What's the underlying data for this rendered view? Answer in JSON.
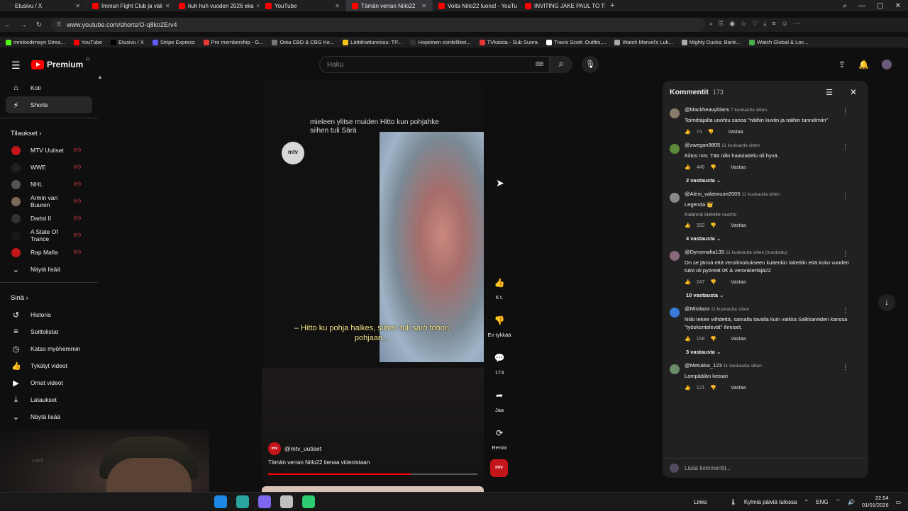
{
  "browser": {
    "tabs": [
      {
        "label": "Etusivu / X",
        "color": "#222222",
        "active": false
      },
      {
        "label": "Immun Fight Club ja vali",
        "color": "#ff0000",
        "active": false
      },
      {
        "label": "huh huh vuoden 2026 eka",
        "color": "#ff0000",
        "active": false
      },
      {
        "label": "YouTube",
        "color": "#ff0000",
        "active": false
      },
      {
        "label": "Tämän verran Niilo22",
        "color": "#ff0000",
        "active": true
      },
      {
        "label": "Voita Niilo22 luona! - YouTu",
        "color": "#ff0000",
        "active": false
      },
      {
        "label": "INVITING JAKE PAUL TO TI",
        "color": "#ff0000",
        "active": false
      }
    ],
    "url": "www.youtube.com/shorts/O-q8ko2Erv4",
    "bookmarks": [
      {
        "label": "mmikedimayn Strea...",
        "color": "#53fc18"
      },
      {
        "label": "YouTube",
        "color": "#ff0000"
      },
      {
        "label": "Etusivu / X",
        "color": "#000000"
      },
      {
        "label": "Stripe Express",
        "color": "#635bff"
      },
      {
        "label": "Pro membership - G...",
        "color": "#e53935"
      },
      {
        "label": "Osta CBD & CBG Ke...",
        "color": "#777777"
      },
      {
        "label": "Lättähattureissu: TP...",
        "color": "#f5c518"
      },
      {
        "label": "Hopeinen cordelliket...",
        "color": "#333333"
      },
      {
        "label": "TVkaista - Sub Suora",
        "color": "#e53935"
      },
      {
        "label": "Travis Scott: Outfits,...",
        "color": "#ffffff"
      },
      {
        "label": "Watch Marvel's Luk...",
        "color": "#aaaaaa"
      },
      {
        "label": "Mighty Ducks: Bank...",
        "color": "#aaaaaa"
      },
      {
        "label": "Watch Global & Loc...",
        "color": "#4caf50"
      }
    ]
  },
  "youtube": {
    "logo_text": "Premium",
    "region": "FI",
    "search_placeholder": "Haku"
  },
  "sidebar": {
    "main": [
      {
        "label": "Koti",
        "icon": "⌂",
        "icon_name": "home-icon",
        "selected": false
      },
      {
        "label": "Shorts",
        "icon": "⚡",
        "icon_name": "shorts-icon",
        "selected": true
      }
    ],
    "subs_heading": "Tilaukset ›",
    "subscriptions": [
      {
        "label": "MTV Uutiset",
        "color": "#c3151a"
      },
      {
        "label": "WWE",
        "color": "#222222"
      },
      {
        "label": "NHL",
        "color": "#555555"
      },
      {
        "label": "Armin van Buuren",
        "color": "#7a6a5a"
      },
      {
        "label": "Dartsi II",
        "color": "#333333"
      },
      {
        "label": "A State Of Trance",
        "color": "#1a1a1a"
      },
      {
        "label": "Rap Mafia",
        "color": "#c3151a"
      }
    ],
    "show_more": "Näytä lisää",
    "you_heading": "Sinä ›",
    "you": [
      {
        "label": "Historia",
        "icon": "↺",
        "icon_name": "history-icon"
      },
      {
        "label": "Soittolistat",
        "icon": "≡",
        "icon_name": "playlists-icon"
      },
      {
        "label": "Katso myöhemmin",
        "icon": "◷",
        "icon_name": "watch-later-icon"
      },
      {
        "label": "Tykätyt videot",
        "icon": "👍",
        "icon_name": "liked-videos-icon"
      },
      {
        "label": "Omat videot",
        "icon": "▶",
        "icon_name": "your-videos-icon"
      },
      {
        "label": "Lataukset",
        "icon": "⤓",
        "icon_name": "downloads-icon"
      },
      {
        "label": "Näytä lisää",
        "icon": "⌄",
        "icon_name": "chevron-down-icon"
      }
    ]
  },
  "video": {
    "watermark": "mtv",
    "caption_top": "mieleen ylitse muiden Hitto kun pohjahke siihen tuli Särä",
    "caption_bottom": "– Hitto ku pohja halkes, siihen tuli särö tohon pohjaan...",
    "channel": "@mtv_uutiset",
    "title": "Tämän verran Niilo22 tienaa videoistaan",
    "progress": 0.68
  },
  "actions": [
    {
      "name": "like",
      "icon": "👍",
      "label": "6 t."
    },
    {
      "name": "dislike",
      "icon": "👎",
      "label": "En tykkää"
    },
    {
      "name": "comments",
      "icon": "💬",
      "label": "173"
    },
    {
      "name": "share",
      "icon": "➦",
      "label": "Jaa"
    },
    {
      "name": "remix",
      "icon": "⟳",
      "label": "Remix"
    }
  ],
  "comments": {
    "title": "Kommentit",
    "count": "173",
    "reply_label": "Vastaa",
    "add_placeholder": "Lisää kommentti...",
    "items": [
      {
        "user": "@blackheavyblans",
        "ago": "7 kuukautta sitten",
        "text": "Toimittajalta unohtu sanoa \"näihin kuviin ja näihin tunnelmiin\"",
        "likes": "74",
        "color": "#8a7a6a",
        "translate": "",
        "replies": ""
      },
      {
        "user": "@zwegan9805",
        "ago": "11 kuukautta sitten",
        "text": "Kiitos mtv. Tää niilo haastattelu oli hyvä.",
        "likes": "446",
        "color": "#5a8a3a",
        "translate": "",
        "replies": "2 vastausta"
      },
      {
        "user": "@Alexi_valasvuori2005",
        "ago": "11 kuukautta sitten",
        "text": "Legenda 👑",
        "likes": "392",
        "color": "#888888",
        "translate": "Käännä kielelle suomi",
        "replies": "4 vastausta"
      },
      {
        "user": "@Dynomafia139",
        "ago": "11 kuukautta sitten (muokattu)",
        "text": "On se jännä että verolimoitukseen kuitenkin laitettiin että koko vuoden tulot oli pyöreät 0€ & veronkiertäjä22",
        "likes": "247",
        "color": "#8a6a7a",
        "translate": "",
        "replies": "10 vastausta"
      },
      {
        "user": "@Mistiaza",
        "ago": "11 kuukautta sitten",
        "text": "Niilo tekee viihdettä, samalla tavalla kuin vaikka Salkkareiden kanssa \"työskentelevät\" ihmiset.",
        "likes": "158",
        "color": "#3a7ad8",
        "translate": "",
        "replies": "3 vastausta"
      },
      {
        "user": "@Metukka_123",
        "ago": "11 kuukautta sitten",
        "text": "Lampäälän keisari",
        "likes": "121",
        "color": "#6a8a6a",
        "translate": "",
        "replies": ""
      }
    ]
  },
  "webcam_text": "sulkit",
  "taskbar": {
    "icons": [
      "#1e88e5",
      "#2aa5a0",
      "#7b68ee",
      "#c0c0c0",
      "#2ecc71"
    ],
    "links_label": "Links",
    "weather": "Kylmiä päiviä tulossa",
    "lang": "ENG",
    "time": "22.54",
    "date": "01/01/2026"
  }
}
